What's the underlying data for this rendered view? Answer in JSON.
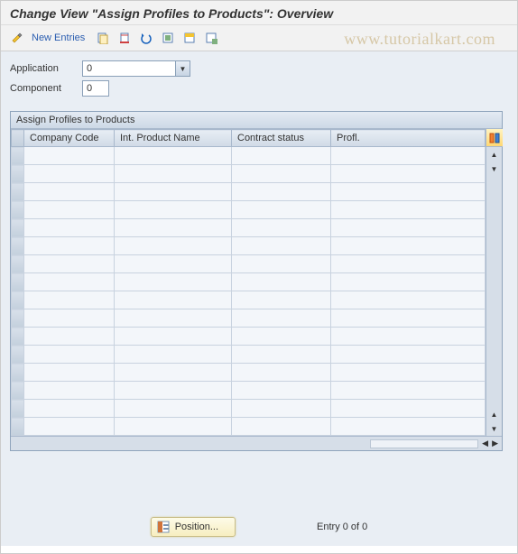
{
  "header": {
    "title": "Change View \"Assign Profiles to Products\": Overview"
  },
  "toolbar": {
    "new_entries": "New Entries"
  },
  "watermark": "www.tutorialkart.com",
  "fields": {
    "application_label": "Application",
    "application_value": "0",
    "component_label": "Component",
    "component_value": "0"
  },
  "panel": {
    "title": "Assign Profiles to Products",
    "columns": [
      "Company Code",
      "Int. Product Name",
      "Contract status",
      "Profl."
    ],
    "row_count": 16
  },
  "footer": {
    "position_label": "Position...",
    "entry_text": "Entry 0 of 0"
  }
}
